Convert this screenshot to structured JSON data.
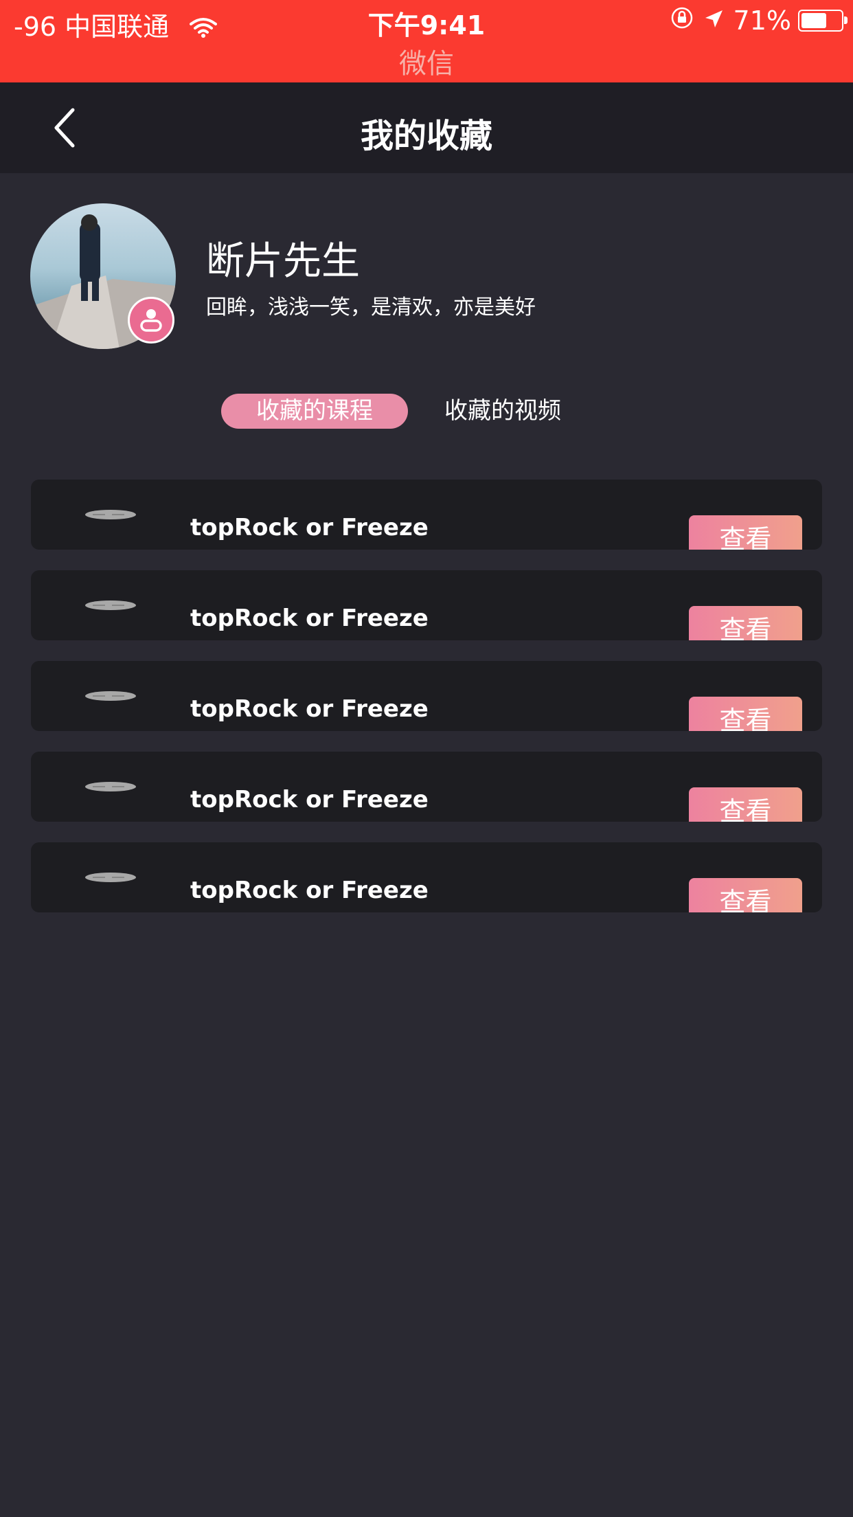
{
  "status_bar": {
    "signal": "-96",
    "carrier": "中国联通",
    "time": "下午9:41",
    "back_to_app": "微信",
    "battery": "71%",
    "battery_level": 0.71,
    "icons": [
      "wifi-icon",
      "rotation-lock-icon",
      "location-icon",
      "battery-icon"
    ]
  },
  "nav": {
    "title": "我的收藏",
    "back_icon": "chevron-left-icon"
  },
  "profile": {
    "name": "断片先生",
    "signature": "回眸，浅浅一笑，是清欢，亦是美好",
    "avatar_icon": "avatar",
    "badge_icon": "user-badge-icon"
  },
  "tabs": [
    {
      "label": "收藏的课程",
      "active": true
    },
    {
      "label": "收藏的视频",
      "active": false
    }
  ],
  "items": [
    {
      "title": "topRock or Freeze",
      "action": "查看"
    },
    {
      "title": "topRock or Freeze",
      "action": "查看"
    },
    {
      "title": "topRock or Freeze",
      "action": "查看"
    },
    {
      "title": "topRock or Freeze",
      "action": "查看"
    },
    {
      "title": "topRock or Freeze",
      "action": "查看"
    }
  ],
  "colors": {
    "status_bar": "#fb3a30",
    "nav_bar": "#1f1e25",
    "background": "#2a2932",
    "card": "#1d1d21",
    "accent_pink": "#e98ea8",
    "button_gradient_start": "#ed829f",
    "button_gradient_end": "#f0a08c"
  }
}
